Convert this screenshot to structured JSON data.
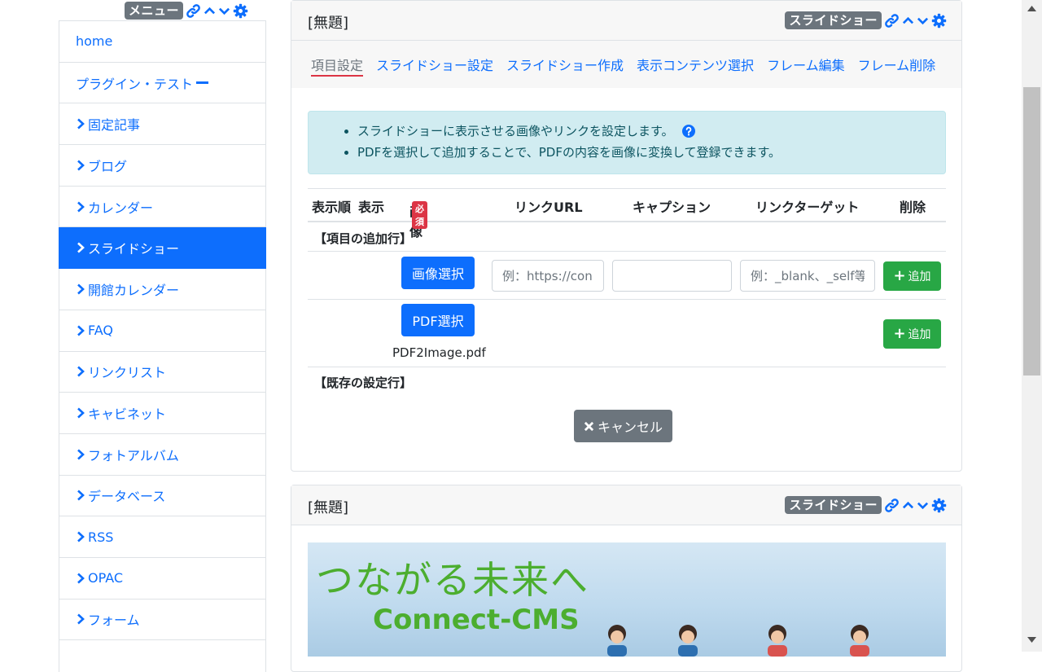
{
  "menu": {
    "badge": "メニュー",
    "items": [
      {
        "label": "home"
      },
      {
        "label": "プラグイン・テスト"
      },
      {
        "label": "固定記事"
      },
      {
        "label": "ブログ"
      },
      {
        "label": "カレンダー"
      },
      {
        "label": "スライドショー",
        "active": true
      },
      {
        "label": "開館カレンダー"
      },
      {
        "label": "FAQ"
      },
      {
        "label": "リンクリスト"
      },
      {
        "label": "キャビネット"
      },
      {
        "label": "フォトアルバム"
      },
      {
        "label": "データベース"
      },
      {
        "label": "RSS"
      },
      {
        "label": "OPAC"
      },
      {
        "label": "フォーム"
      }
    ]
  },
  "frame1": {
    "title": "[無題]",
    "plugin_badge": "スライドショー",
    "tabs": [
      "項目設定",
      "スライドショー設定",
      "スライドショー作成",
      "表示コンテンツ選択",
      "フレーム編集",
      "フレーム削除"
    ],
    "info": [
      "スライドショーに表示させる画像やリンクを設定します。",
      "PDFを選択して追加することで、PDFの内容を画像に変換して登録できます。"
    ],
    "columns": {
      "order": "表示順",
      "display": "表示",
      "image": "画像",
      "required": "必須",
      "link_url": "リンクURL",
      "caption": "キャプション",
      "link_target": "リンクターゲット",
      "delete": "削除"
    },
    "add_row_label": "【項目の追加行】",
    "image_select_btn": "画像選択",
    "link_url_placeholder": "例：https://connect-cms.jp",
    "caption_value": "",
    "target_placeholder": "例：_blank、_self等",
    "add_btn": "追加",
    "pdf_select_btn": "PDF選択",
    "pdf_filename": "PDF2Image.pdf",
    "existing_row_label": "【既存の設定行】",
    "cancel_btn": "キャンセル"
  },
  "frame2": {
    "title": "[無題]",
    "plugin_badge": "スライドショー",
    "slide_text_1": "つながる未来へ",
    "slide_text_2": "Connect-CMS"
  },
  "colors": {
    "primary": "#0d6efd",
    "success": "#28a745",
    "secondary": "#6c757d",
    "danger": "#dc3545",
    "info_bg": "#d1ecf1"
  }
}
